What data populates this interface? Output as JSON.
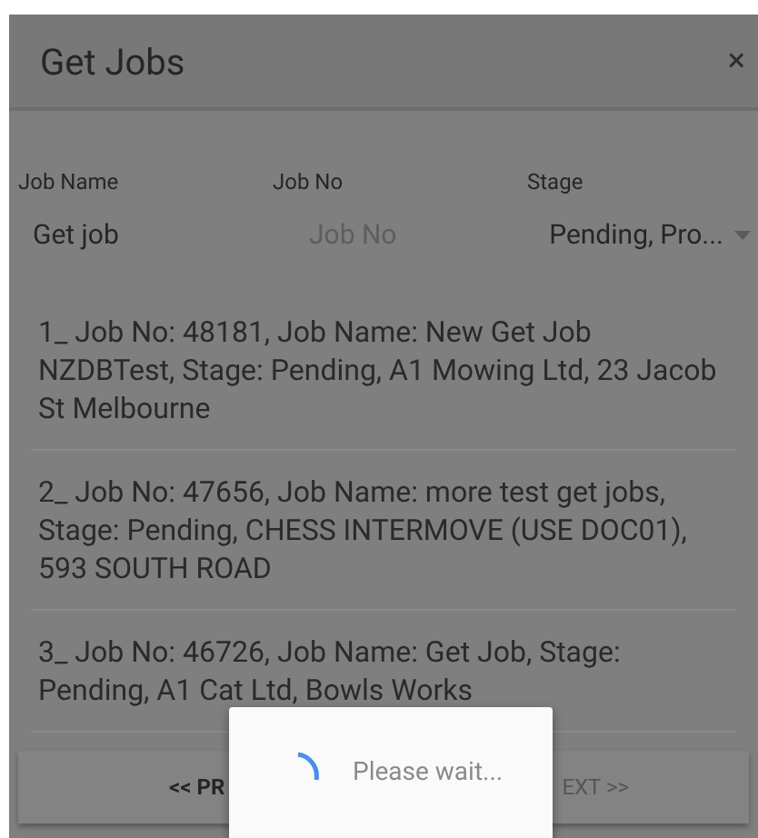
{
  "dialog": {
    "title": "Get Jobs",
    "close": "×"
  },
  "filters": [
    {
      "kind": "text",
      "label": "Job Name",
      "value": "Get job"
    },
    {
      "kind": "text",
      "label": "Job No",
      "placeholder": "Job No"
    },
    {
      "kind": "select",
      "label": "Stage",
      "value": "Pending, Pro..."
    }
  ],
  "jobs": [
    "1_ Job No: 48181, Job Name: New Get Job NZDBTest, Stage: Pending, A1 Mowing Ltd, 23 Jacob St Melbourne",
    "2_ Job No: 47656, Job Name: more test get jobs, Stage: Pending, CHESS INTERMOVE (USE DOC01), 593 SOUTH ROAD",
    "3_ Job No: 46726, Job Name: Get Job, Stage: Pending, A1 Cat Ltd, Bowls Works"
  ],
  "pager": {
    "previous": "<< PR",
    "next": "EXT >>"
  },
  "loading": {
    "message": "Please wait..."
  }
}
